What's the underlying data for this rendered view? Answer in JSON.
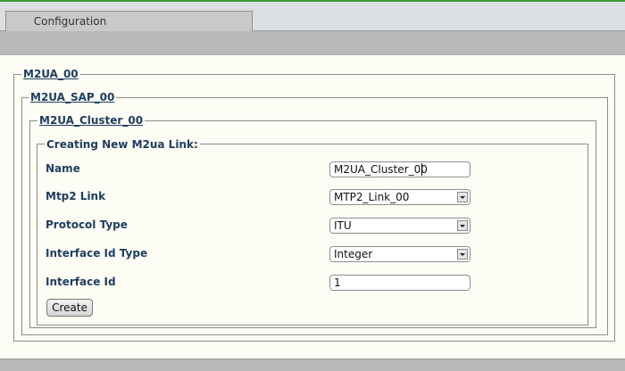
{
  "tabs": {
    "active": "Configuration"
  },
  "breadcrumb": {
    "level1": "M2UA_00",
    "level2": "M2UA_SAP_00",
    "level3": "M2UA_Cluster_00",
    "form_title": "Creating New M2ua Link:"
  },
  "form": {
    "name": {
      "label": "Name",
      "value": "M2UA_Cluster_00"
    },
    "mtp2_link": {
      "label": "Mtp2 Link",
      "value": "MTP2_Link_00"
    },
    "protocol_type": {
      "label": "Protocol Type",
      "value": "ITU"
    },
    "interface_id_type": {
      "label": "Interface Id Type",
      "value": "Integer"
    },
    "interface_id": {
      "label": "Interface Id",
      "value": "1"
    }
  },
  "actions": {
    "create_label": "Create"
  },
  "icons": {
    "select_arrow": "chevron-down-icon"
  }
}
